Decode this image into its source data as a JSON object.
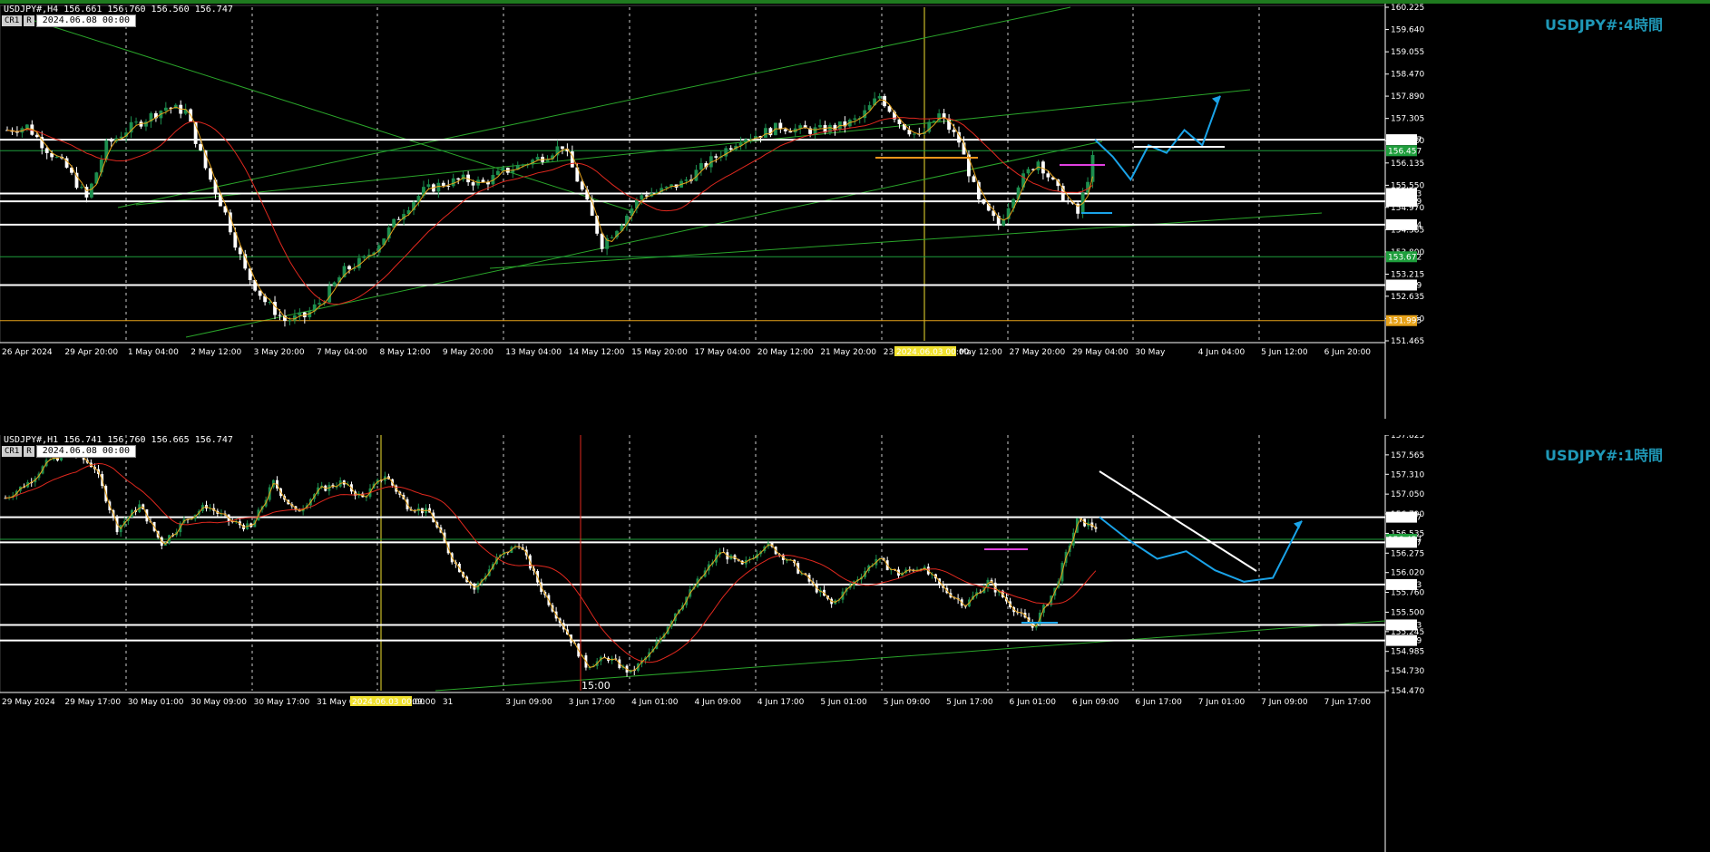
{
  "h4": {
    "header": "USDJPY#,H4  156.661 156.760 156.560 156.747",
    "ctl_buttons": [
      "CR1",
      "R"
    ],
    "date_box": "2024.06.08 00:00",
    "watermark": "USDJPY#:4時間",
    "price_ticks": [
      "160.225",
      "159.640",
      "159.055",
      "158.470",
      "157.890",
      "157.305",
      "156.720",
      "156.135",
      "155.550",
      "154.970",
      "154.385",
      "153.800",
      "153.215",
      "152.635",
      "152.050",
      "151.465"
    ],
    "price_badges": [
      {
        "label": "156.747",
        "bg": "#ffffff",
        "fg": "#000000"
      },
      {
        "label": "156.457",
        "bg": "#1e9e3c",
        "fg": "#000000"
      },
      {
        "label": "155.333",
        "bg": "#ffffff",
        "fg": "#000000"
      },
      {
        "label": "155.129",
        "bg": "#ffffff",
        "fg": "#000000"
      },
      {
        "label": "154.514",
        "bg": "#ffffff",
        "fg": "#000000"
      },
      {
        "label": "153.672",
        "bg": "#1e9e3c",
        "fg": "#000000"
      },
      {
        "label": "152.929",
        "bg": "#ffffff",
        "fg": "#000000"
      },
      {
        "label": "151.995",
        "bg": "#e6a21a",
        "fg": "#000000"
      }
    ],
    "time_labels": [
      "26 Apr 2024",
      "29 Apr 20:00",
      "1 May 04:00",
      "2 May 12:00",
      "3 May 20:00",
      "7 May 04:00",
      "8 May 12:00",
      "9 May 20:00",
      "13 May 04:00",
      "14 May 12:00",
      "15 May 20:00",
      "17 May 04:00",
      "20 May 12:00",
      "21 May 20:00",
      "23 May 04:00",
      "24 May 12:00",
      "27 May 20:00",
      "29 May 04:00",
      "30 May",
      "4 Jun 04:00",
      "5 Jun 12:00",
      "6 Jun 20:00"
    ],
    "highlight_time": "2024.06.03 00:00",
    "chart_data": {
      "type": "candlestick",
      "symbol": "USDJPY#",
      "timeframe": "H4",
      "ohlc_last": {
        "open": 156.661,
        "high": 156.76,
        "low": 156.56,
        "close": 156.747
      },
      "horizontal_levels": [
        156.747,
        156.457,
        155.333,
        155.129,
        154.514,
        153.672,
        152.929,
        151.995
      ],
      "close_path": [
        157.0,
        157.1,
        156.5,
        156.0,
        155.2,
        156.6,
        157.0,
        157.3,
        157.6,
        157.5,
        156.0,
        154.8,
        153.3,
        152.5,
        152.0,
        152.1,
        152.6,
        153.3,
        153.6,
        154.2,
        154.9,
        155.4,
        155.6,
        155.7,
        155.6,
        155.9,
        156.1,
        156.3,
        156.6,
        155.4,
        154.0,
        154.6,
        155.3,
        155.4,
        155.6,
        156.0,
        156.4,
        156.8,
        156.9,
        157.1,
        157.0,
        157.0,
        157.1,
        157.3,
        157.9,
        157.2,
        156.8,
        157.4,
        156.7,
        155.1,
        154.5,
        155.6,
        156.2,
        155.4,
        154.8,
        156.7
      ],
      "forecast_h4": [
        156.747,
        156.3,
        155.7,
        156.6,
        156.4,
        157.0,
        156.6,
        157.9
      ]
    },
    "colors": {
      "bull": "#1d8f4f",
      "bear": "#ffffff",
      "ma_fast": "#e6a21a",
      "ma_slow": "#e0281e",
      "forecast": "#1aa3e8"
    }
  },
  "h1": {
    "header": "USDJPY#,H1  156.741 156.760 156.665 156.747",
    "ctl_buttons": [
      "CR1",
      "R"
    ],
    "date_box": "2024.06.08 00:00",
    "watermark": "USDJPY#:1時間",
    "price_ticks": [
      "157.825",
      "157.565",
      "157.310",
      "157.050",
      "156.790",
      "156.535",
      "156.275",
      "156.020",
      "155.760",
      "155.500",
      "155.245",
      "154.985",
      "154.730",
      "154.470"
    ],
    "price_badges": [
      {
        "label": "156.747",
        "bg": "#ffffff",
        "fg": "#000000"
      },
      {
        "label": "156.457",
        "bg": "#1e9e3c",
        "fg": "#000000"
      },
      {
        "label": "156.417",
        "bg": "#ffffff",
        "fg": "#000000"
      },
      {
        "label": "155.863",
        "bg": "#ffffff",
        "fg": "#000000"
      },
      {
        "label": "155.333",
        "bg": "#ffffff",
        "fg": "#000000"
      },
      {
        "label": "155.129",
        "bg": "#ffffff",
        "fg": "#000000"
      }
    ],
    "time_labels": [
      "29 May 2024",
      "29 May 17:00",
      "30 May 01:00",
      "30 May 09:00",
      "30 May 17:00",
      "31 May 01:00",
      "31 May 09:00",
      "31",
      "3 Jun 09:00",
      "3 Jun 17:00",
      "4 Jun 01:00",
      "4 Jun 09:00",
      "4 Jun 17:00",
      "5 Jun 01:00",
      "5 Jun 09:00",
      "5 Jun 17:00",
      "6 Jun 01:00",
      "6 Jun 09:00",
      "6 Jun 17:00",
      "7 Jun 01:00",
      "7 Jun 09:00",
      "7 Jun 17:00"
    ],
    "highlight_time": "2024.06.03 00:00",
    "marker_label": "15:00",
    "chart_data": {
      "type": "candlestick",
      "symbol": "USDJPY#",
      "timeframe": "H1",
      "ohlc_last": {
        "open": 156.741,
        "high": 156.76,
        "low": 156.665,
        "close": 156.747
      },
      "horizontal_levels": [
        156.747,
        156.457,
        156.417,
        155.863,
        155.333,
        155.129
      ],
      "close_path": [
        157.0,
        157.2,
        157.5,
        157.6,
        157.4,
        156.6,
        156.9,
        156.4,
        156.7,
        156.9,
        156.7,
        156.6,
        157.2,
        156.8,
        157.1,
        157.2,
        157.0,
        157.3,
        156.9,
        156.8,
        156.2,
        155.8,
        156.2,
        156.4,
        155.8,
        155.3,
        154.8,
        154.9,
        154.7,
        155.0,
        155.5,
        155.9,
        156.3,
        156.1,
        156.4,
        156.2,
        155.9,
        155.6,
        155.9,
        156.2,
        156.0,
        156.1,
        155.8,
        155.6,
        155.9,
        155.6,
        155.3,
        155.8,
        156.7,
        156.6
      ],
      "forecast_h1": [
        156.747,
        156.45,
        156.2,
        156.3,
        156.05,
        155.9,
        155.95,
        156.7
      ]
    },
    "colors": {
      "bull": "#1d8f4f",
      "bear": "#ffffff",
      "ma_fast": "#e6a21a",
      "ma_slow": "#e0281e",
      "forecast": "#1aa3e8"
    }
  }
}
